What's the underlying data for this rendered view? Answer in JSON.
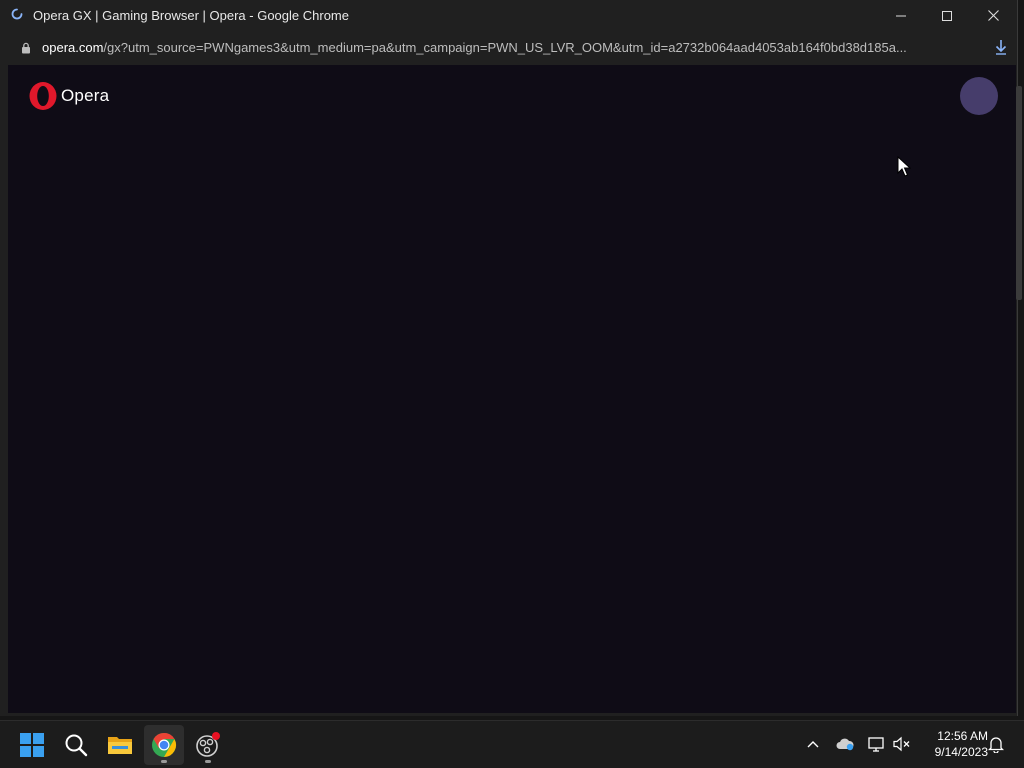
{
  "window": {
    "title": "Opera GX | Gaming Browser | Opera - Google Chrome",
    "url_domain": "opera.com",
    "url_rest": "/gx?utm_source=PWNgames3&utm_medium=pa&utm_campaign=PWN_US_LVR_OOM&utm_id=a2732b064aad4053ab164f0bd38d185a..."
  },
  "page": {
    "logo_text": "Opera",
    "background_color": "#0f0c16",
    "avatar_color": "#463d6b",
    "brand_color": "#e0182b"
  },
  "taskbar": {
    "apps": [
      {
        "name": "start-icon"
      },
      {
        "name": "search-icon"
      },
      {
        "name": "file-explorer-icon"
      },
      {
        "name": "chrome-icon"
      },
      {
        "name": "obs-icon"
      }
    ],
    "time": "12:56 AM",
    "date": "9/14/2023"
  }
}
